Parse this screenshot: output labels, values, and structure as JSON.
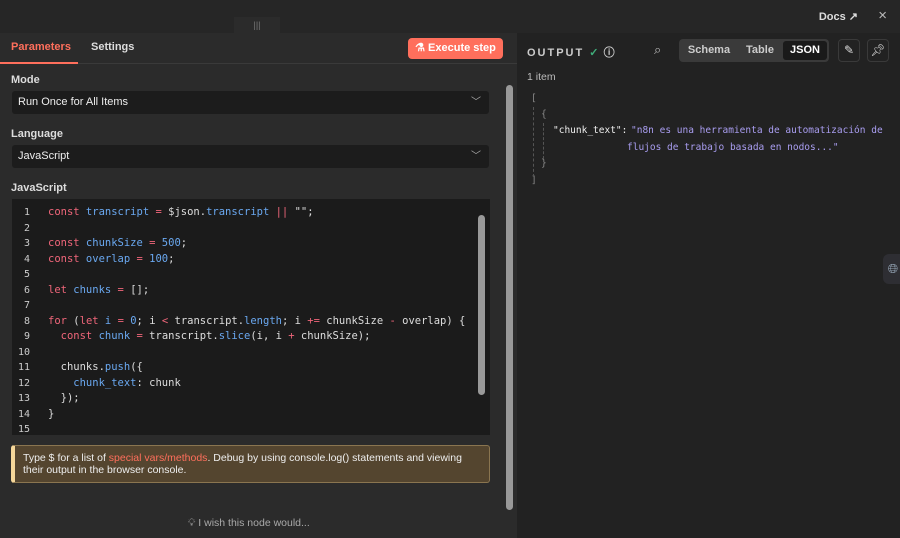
{
  "header": {
    "docs_label": "Docs",
    "close_label": "×"
  },
  "tabs": [
    {
      "label": "Parameters",
      "active": true
    },
    {
      "label": "Settings",
      "active": false
    }
  ],
  "execute_label": "Execute step",
  "mode": {
    "label": "Mode",
    "value": "Run Once for All Items"
  },
  "language": {
    "label": "Language",
    "value": "JavaScript"
  },
  "code_label": "JavaScript",
  "code_lines": [
    [
      [
        "const",
        "k"
      ],
      [
        " transcript ",
        "v"
      ],
      [
        "=",
        "o"
      ],
      [
        " $json.",
        "p"
      ],
      [
        "transcript",
        "v"
      ],
      [
        " || ",
        "o"
      ],
      [
        "\"\";",
        "p"
      ]
    ],
    [],
    [
      [
        "const",
        "k"
      ],
      [
        " chunkSize ",
        "v"
      ],
      [
        "=",
        "o"
      ],
      [
        " 500",
        "n"
      ],
      [
        ";",
        "p"
      ]
    ],
    [
      [
        "const",
        "k"
      ],
      [
        " overlap ",
        "v"
      ],
      [
        "=",
        "o"
      ],
      [
        " 100",
        "n"
      ],
      [
        ";",
        "p"
      ]
    ],
    [],
    [
      [
        "let",
        "k"
      ],
      [
        " chunks ",
        "v"
      ],
      [
        "=",
        "o"
      ],
      [
        " [];",
        "p"
      ]
    ],
    [],
    [
      [
        "for",
        "k"
      ],
      [
        " (",
        "p"
      ],
      [
        "let",
        "k"
      ],
      [
        " i ",
        "v"
      ],
      [
        "=",
        "o"
      ],
      [
        " 0",
        "n"
      ],
      [
        "; i ",
        "p"
      ],
      [
        "<",
        "o"
      ],
      [
        " transcript.",
        "p"
      ],
      [
        "length",
        "f"
      ],
      [
        "; i ",
        "p"
      ],
      [
        "+=",
        "o"
      ],
      [
        " chunkSize ",
        "p"
      ],
      [
        "-",
        "o"
      ],
      [
        " overlap) {",
        "p"
      ]
    ],
    [
      [
        "  const",
        "k"
      ],
      [
        " chunk ",
        "v"
      ],
      [
        "=",
        "o"
      ],
      [
        " transcript.",
        "p"
      ],
      [
        "slice",
        "f"
      ],
      [
        "(i, i ",
        "p"
      ],
      [
        "+",
        "o"
      ],
      [
        " chunkSize);",
        "p"
      ]
    ],
    [],
    [
      [
        "  chunks.",
        "p"
      ],
      [
        "push",
        "f"
      ],
      [
        "({",
        "p"
      ]
    ],
    [
      [
        "    chunk_text",
        "v"
      ],
      [
        ": chunk",
        "p"
      ]
    ],
    [
      [
        "  });",
        "p"
      ]
    ],
    [
      [
        "}",
        "p"
      ]
    ],
    []
  ],
  "hint": {
    "prefix": "Type $ for a list of ",
    "link": "special vars/methods",
    "suffix": ". Debug by using console.log() statements and viewing their output in the browser console."
  },
  "wish_label": "I wish this node would...",
  "output": {
    "title": "OUTPUT",
    "views": [
      {
        "label": "Schema",
        "active": false
      },
      {
        "label": "Table",
        "active": false
      },
      {
        "label": "JSON",
        "active": true
      }
    ],
    "item_count": "1 item",
    "json": {
      "open_bracket": "[",
      "open_brace": "{",
      "key": "\"chunk_text\":",
      "value_line1": "\"n8n es una herramienta de automatización de",
      "value_line2": "flujos de trabajo basada en nodos...\"",
      "close_brace": "}",
      "close_bracket": "]"
    }
  },
  "colors": {
    "accent": "#ff6f5c",
    "success": "#3fae7a",
    "json_string": "#a99df0"
  }
}
